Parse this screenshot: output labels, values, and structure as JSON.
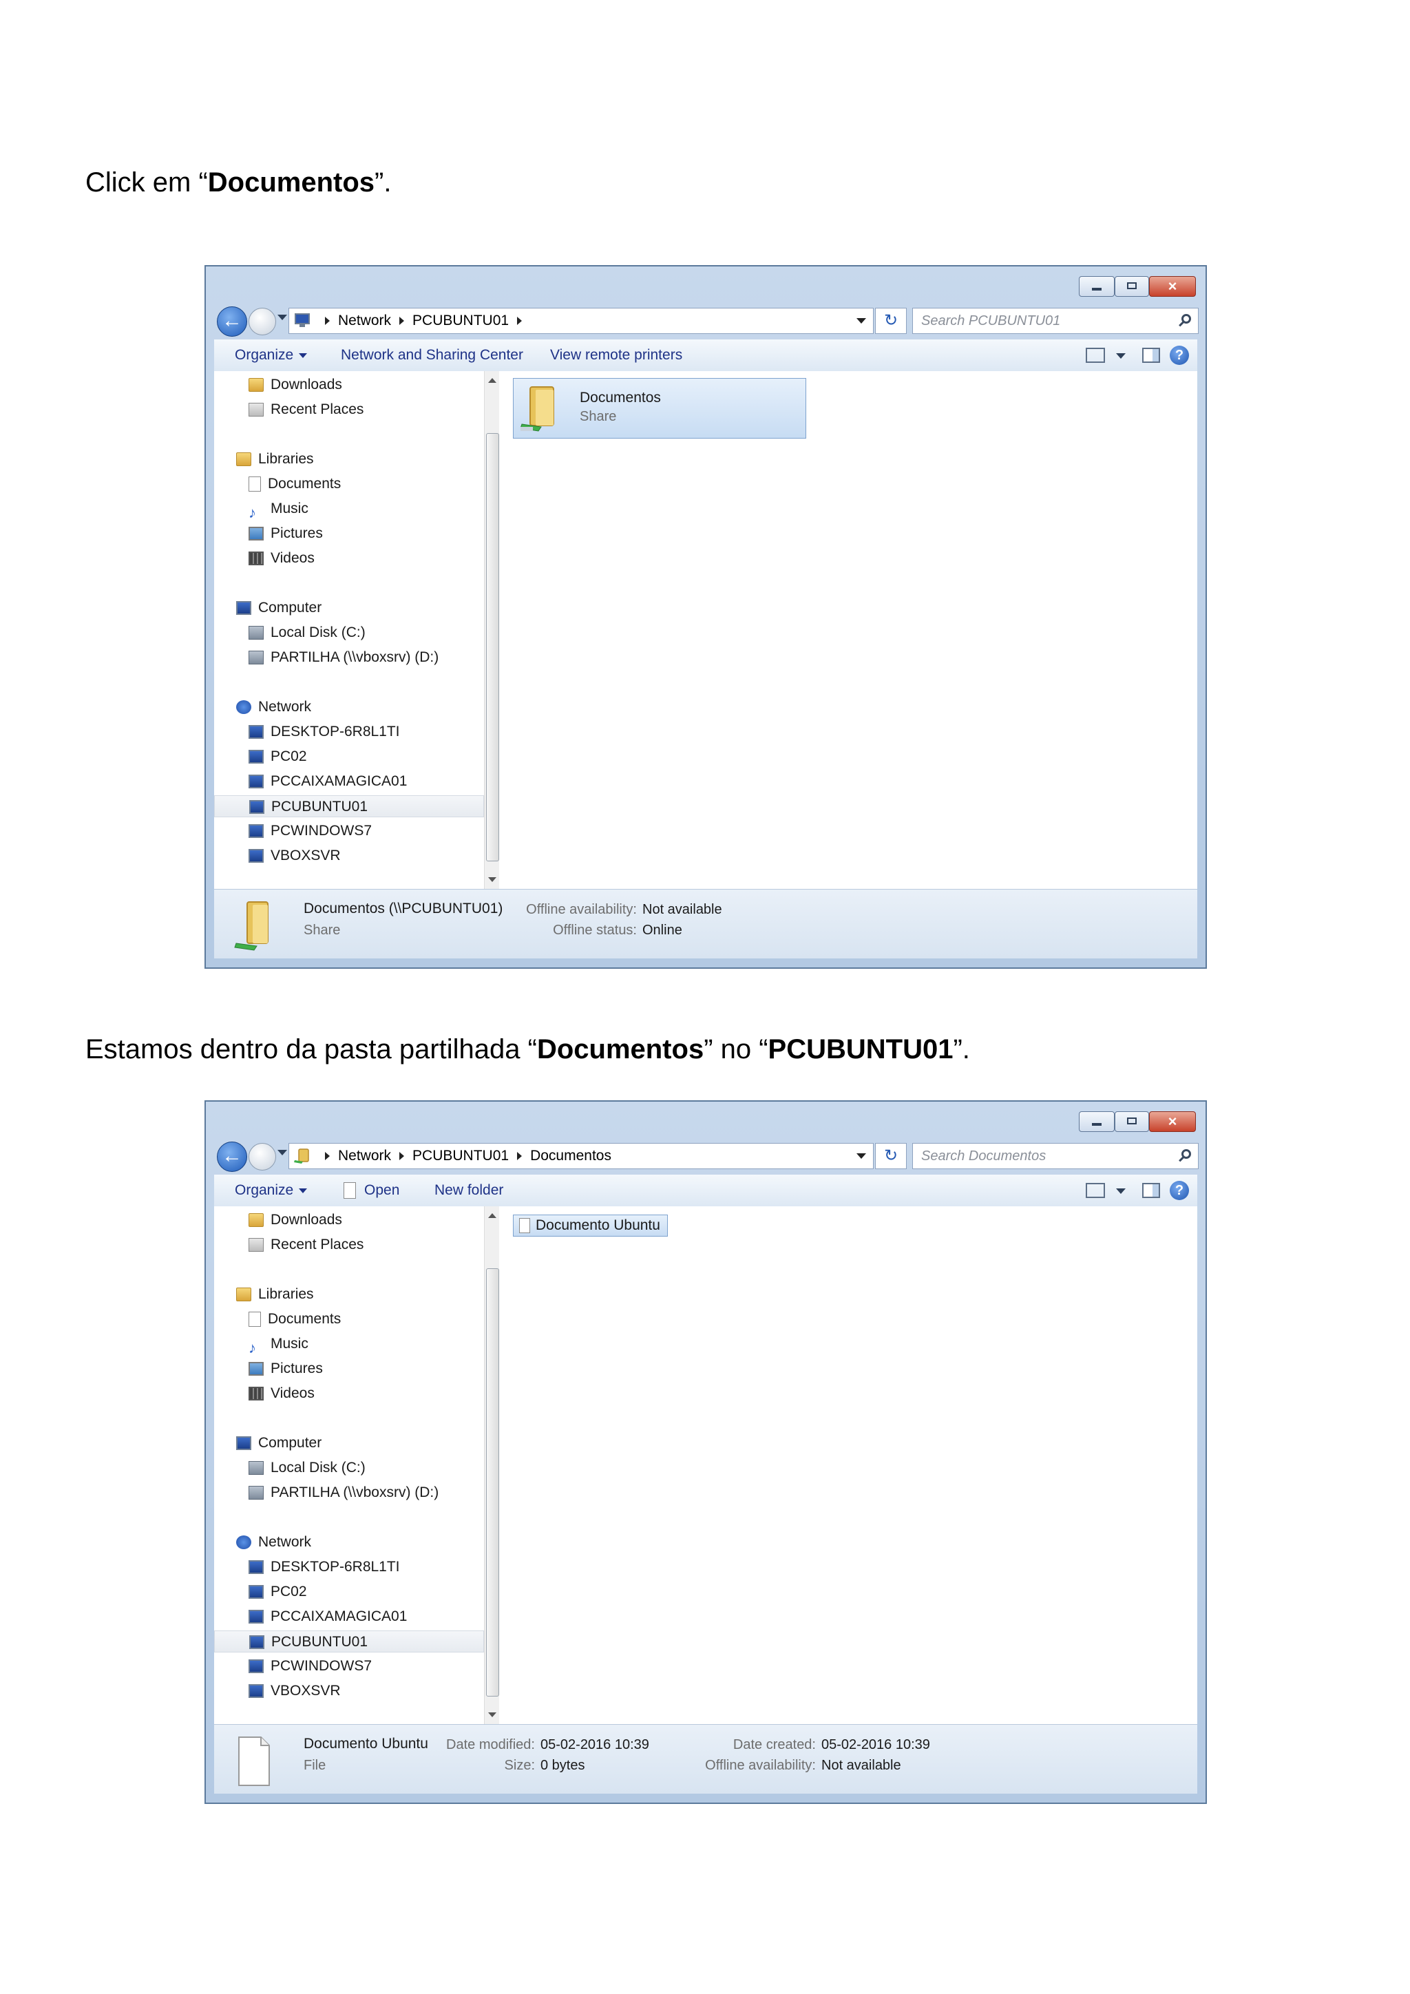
{
  "step1": {
    "caption": {
      "before": "Click em “",
      "bold": "Documentos",
      "after": "”."
    },
    "window": {
      "breadcrumbs": [
        "Network",
        "PCUBUNTU01"
      ],
      "search_placeholder": "Search PCUBUNTU01",
      "commands": {
        "organize": "Organize",
        "network_sharing": "Network and Sharing Center",
        "remote_printers": "View remote printers"
      },
      "item": {
        "name": "Documentos",
        "type": "Share"
      },
      "details": {
        "name": "Documentos (\\\\PCUBUNTU01)",
        "type": "Share",
        "offline_availability_label": "Offline availability:",
        "offline_availability_value": "Not available",
        "offline_status_label": "Offline status:",
        "offline_status_value": "Online"
      }
    }
  },
  "step2": {
    "caption": {
      "before": "Estamos dentro da pasta partilhada “",
      "bold1": "Documentos",
      "middle": "” no “",
      "bold2": "PCUBUNTU01",
      "after": "”."
    },
    "window": {
      "breadcrumbs": [
        "Network",
        "PCUBUNTU01",
        "Documentos"
      ],
      "search_placeholder": "Search Documentos",
      "commands": {
        "organize": "Organize",
        "open": "Open",
        "new_folder": "New folder"
      },
      "item": {
        "name": "Documento Ubuntu"
      },
      "details": {
        "name": "Documento Ubuntu",
        "type": "File",
        "date_modified_label": "Date modified:",
        "date_modified_value": "05-02-2016 10:39",
        "size_label": "Size:",
        "size_value": "0 bytes",
        "date_created_label": "Date created:",
        "date_created_value": "05-02-2016 10:39",
        "offline_availability_label": "Offline availability:",
        "offline_availability_value": "Not available"
      }
    }
  },
  "nav": {
    "downloads": "Downloads",
    "recent_places": "Recent Places",
    "libraries": "Libraries",
    "documents": "Documents",
    "music": "Music",
    "pictures": "Pictures",
    "videos": "Videos",
    "computer": "Computer",
    "local_disk": "Local Disk (C:)",
    "partilha": "PARTILHA (\\\\vboxsrv) (D:)",
    "network": "Network",
    "desktop": "DESKTOP-6R8L1TI",
    "pc02": "PC02",
    "pccaixa": "PCCAIXAMAGICA01",
    "pcubuntu": "PCUBUNTU01",
    "pcwindows": "PCWINDOWS7",
    "vboxsvr": "VBOXSVR"
  },
  "icons": {
    "close": "×",
    "refresh": "↻",
    "help": "?",
    "music_note": "♪"
  }
}
